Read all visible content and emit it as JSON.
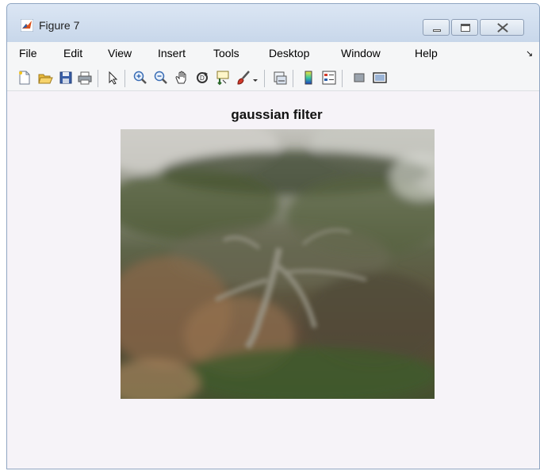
{
  "window": {
    "title": "Figure 7",
    "icon": "matlab-logo-icon",
    "controls": [
      "minimize-icon",
      "maximize-icon",
      "close-icon"
    ]
  },
  "menu": {
    "items": [
      "File",
      "Edit",
      "View",
      "Insert",
      "Tools",
      "Desktop",
      "Window",
      "Help"
    ],
    "overflow_icon": "menu-arrow-icon",
    "overflow_glyph": "↘"
  },
  "toolbar": {
    "buttons": [
      "new-figure-icon",
      "open-file-icon",
      "save-icon",
      "print-icon",
      "edit-plot-arrow-icon",
      "zoom-in-icon",
      "zoom-out-icon",
      "pan-hand-icon",
      "rotate-3d-icon",
      "data-cursor-icon",
      "brush-icon",
      "brush-dropdown-icon",
      "link-plot-icon",
      "colorbar-icon",
      "legend-icon",
      "hide-plot-tools-icon",
      "show-plot-tools-icon"
    ]
  },
  "figure": {
    "title": "gaussian filter",
    "image_description_icon": "blurred-cypress-tree-photo"
  },
  "colors": {
    "titlebar": "#cfdcec",
    "menubar": "#f5f6f7",
    "canvas": "#f6f3f8",
    "image_fog": "#b9b8b2",
    "image_foliage": "#4b5a3a",
    "image_earth": "#7a5c42"
  }
}
